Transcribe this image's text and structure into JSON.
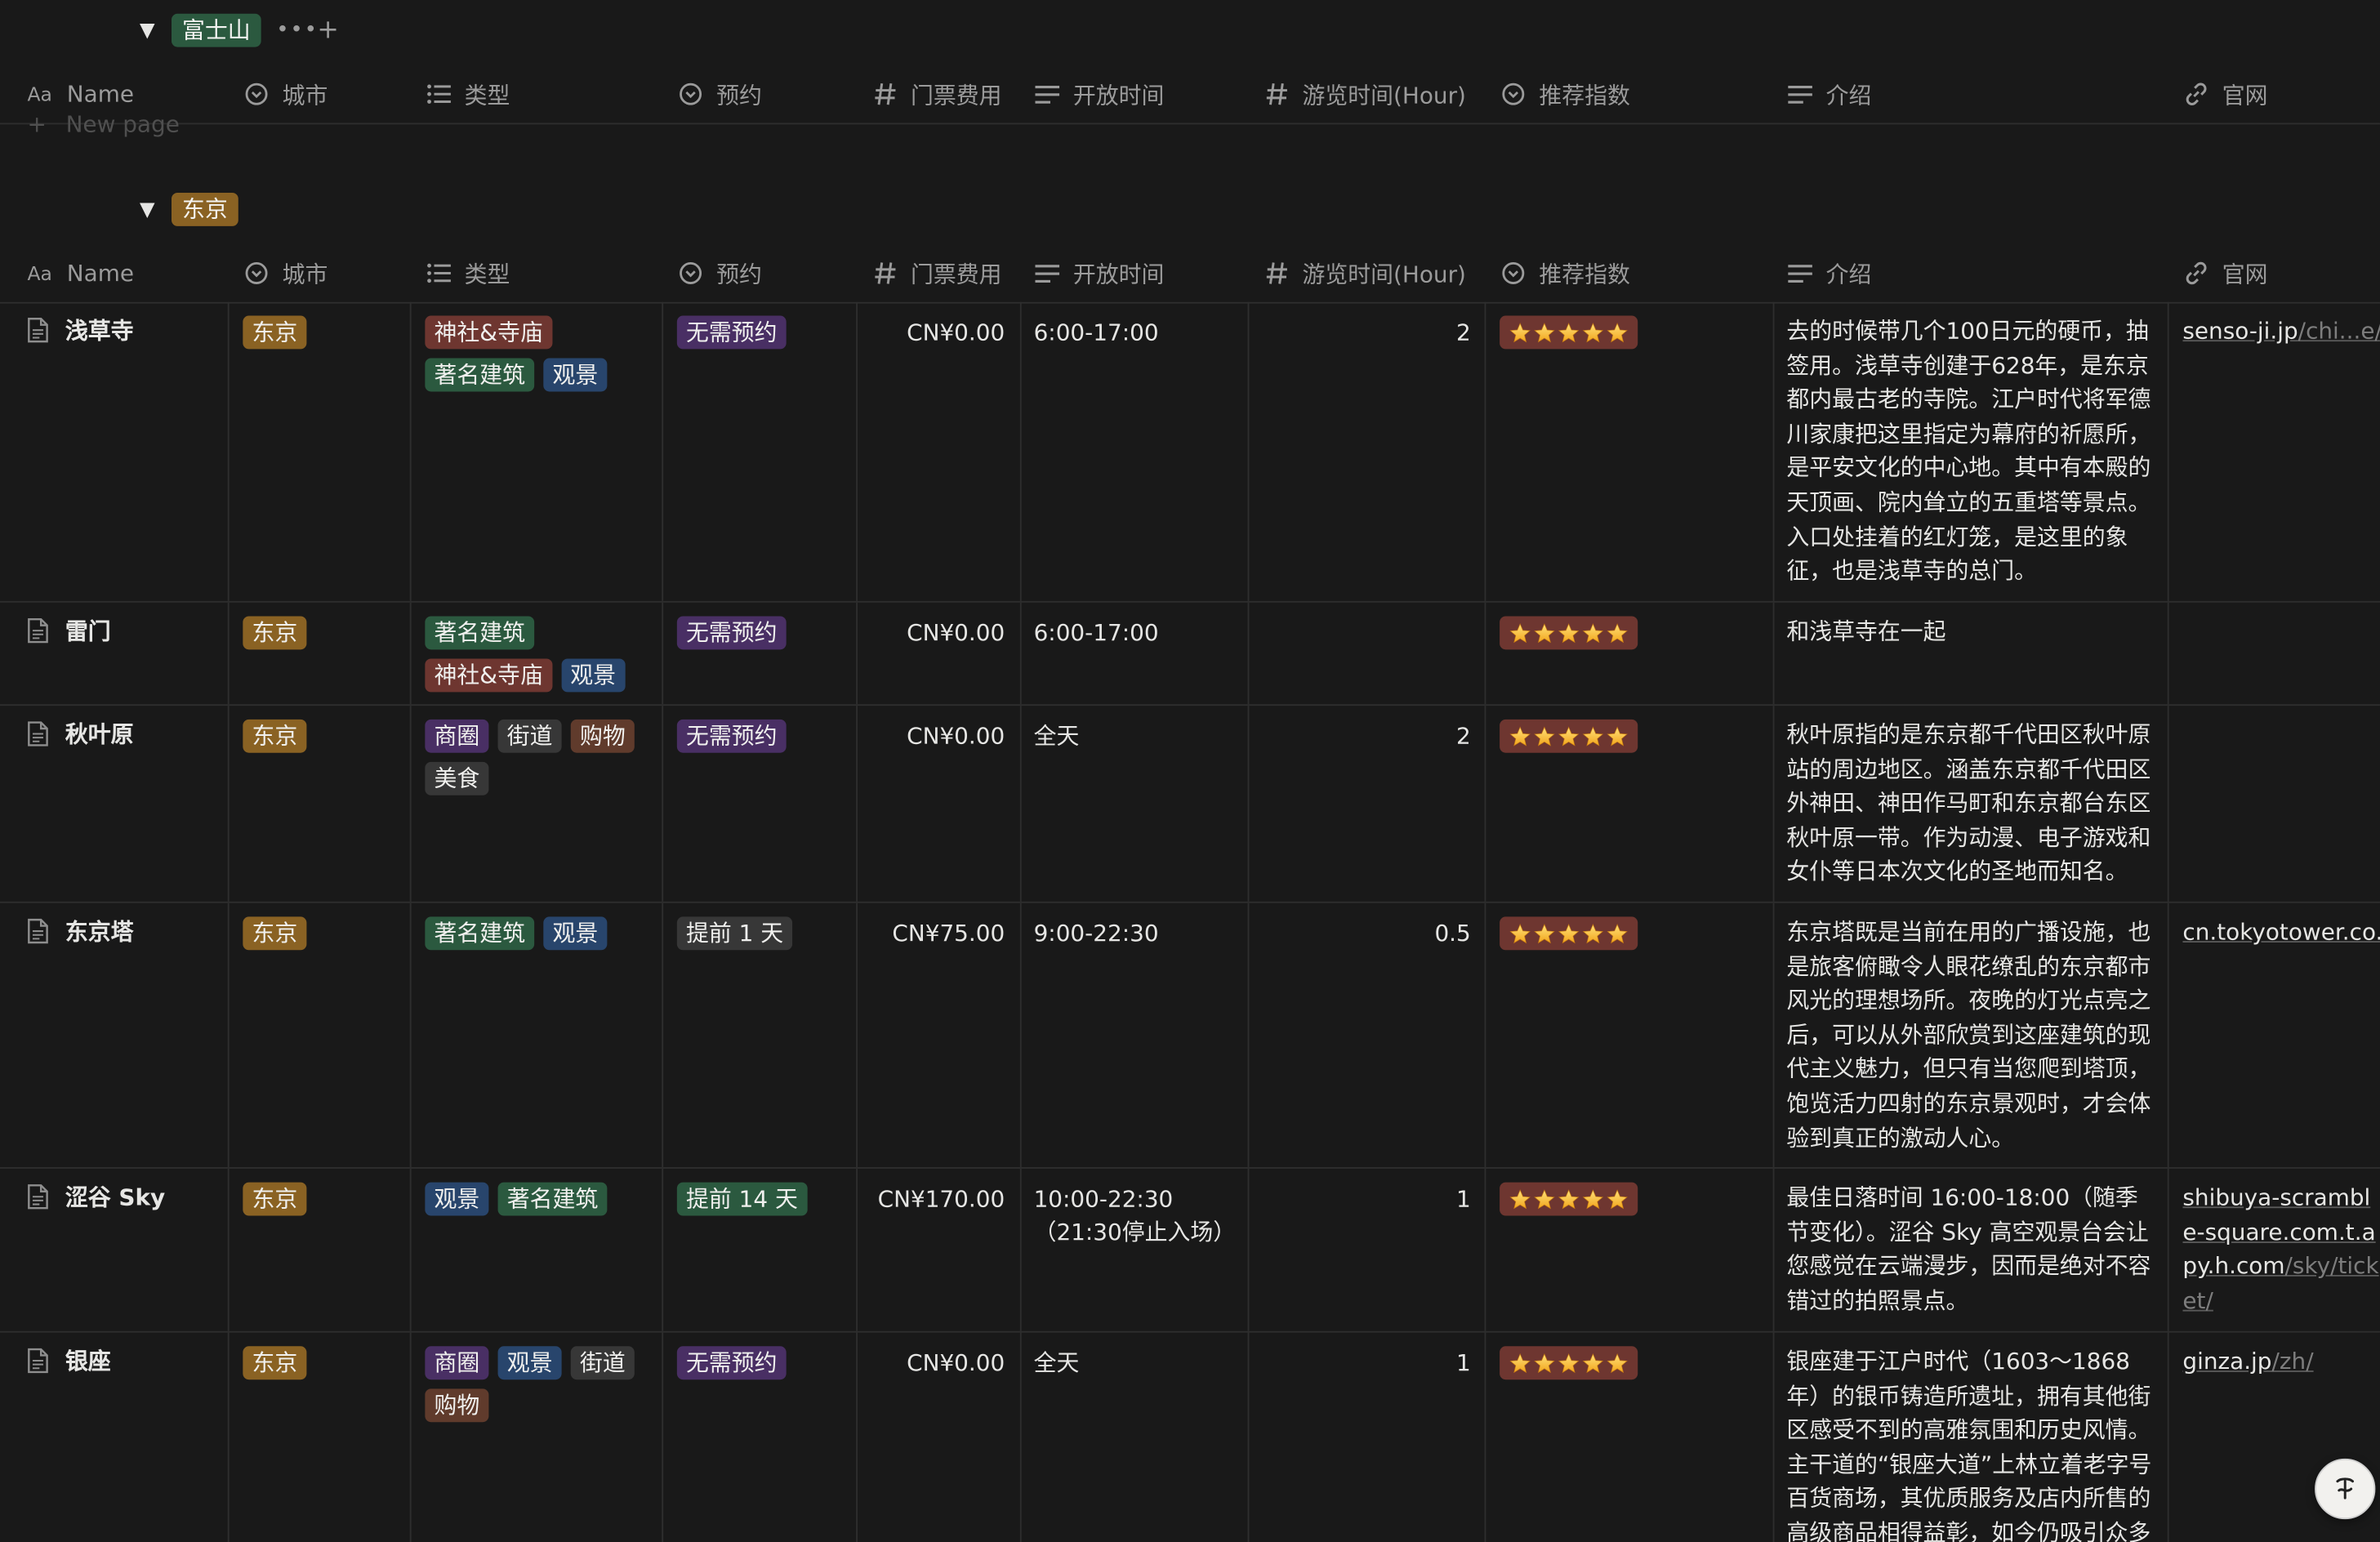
{
  "colors": {
    "background": "#191919",
    "text": "#e6e6e4",
    "muted": "#9b9b9b",
    "divider": "#2e2e2e",
    "tag_green": "#2b593f",
    "tag_brown": "#8a6223",
    "tag_red": "#6e3630",
    "tag_blue": "#28456c",
    "tag_purple": "#492f64",
    "tag_gray": "#373737",
    "tag_orange_brown": "#603b2c"
  },
  "groups": {
    "fuji": {
      "label": "富士山",
      "new_page_label": "New page"
    },
    "tokyo": {
      "label": "东京"
    }
  },
  "columns": {
    "name": "Name",
    "city": "城市",
    "type": "类型",
    "booking": "预约",
    "fee": "门票费用",
    "hours": "开放时间",
    "duration": "游览时间(Hour)",
    "rating": "推荐指数",
    "intro": "介绍",
    "website": "官网"
  },
  "icons": {
    "name": "text-aa-icon",
    "city": "select-icon",
    "type": "multi-select-icon",
    "booking": "select-icon",
    "fee": "number-icon",
    "hours": "text-lines-icon",
    "duration": "number-icon",
    "rating": "select-icon",
    "intro": "text-lines-icon",
    "website": "link-icon"
  },
  "rows": [
    {
      "name": "浅草寺",
      "city": "东京",
      "types": [
        {
          "label": "神社&寺庙",
          "color": "red"
        },
        {
          "label": "著名建筑",
          "color": "green"
        },
        {
          "label": "观景",
          "color": "blue"
        }
      ],
      "booking": {
        "label": "无需预约",
        "color": "purple"
      },
      "fee": "CN¥0.00",
      "hours": "6:00-17:00",
      "duration": "2",
      "rating": 5,
      "intro": "去的时候带几个100日元的硬币，抽签用。浅草寺创建于628年，是东京都内最古老的寺院。江户时代将军德川家康把这里指定为幕府的祈愿所，是平安文化的中心地。其中有本殿的天顶画、院内耸立的五重塔等景点。入口处挂着的红灯笼，是这里的象征，也是浅草寺的总门。",
      "website_main": "senso-ji.jp",
      "website_dim": "/chi...e/k"
    },
    {
      "name": "雷门",
      "city": "东京",
      "types": [
        {
          "label": "著名建筑",
          "color": "green"
        },
        {
          "label": "神社&寺庙",
          "color": "red"
        },
        {
          "label": "观景",
          "color": "blue"
        }
      ],
      "booking": {
        "label": "无需预约",
        "color": "purple"
      },
      "fee": "CN¥0.00",
      "hours": "6:00-17:00",
      "duration": "",
      "rating": 5,
      "intro": "和浅草寺在一起",
      "website_main": "",
      "website_dim": ""
    },
    {
      "name": "秋叶原",
      "city": "东京",
      "types": [
        {
          "label": "商圈",
          "color": "purple"
        },
        {
          "label": "街道",
          "color": "gray"
        },
        {
          "label": "购物",
          "color": "orange_brown"
        },
        {
          "label": "美食",
          "color": "gray"
        }
      ],
      "booking": {
        "label": "无需预约",
        "color": "purple"
      },
      "fee": "CN¥0.00",
      "hours": "全天",
      "duration": "2",
      "rating": 5,
      "intro": "秋叶原指的是东京都千代田区秋叶原站的周边地区。涵盖东京都千代田区外神田、神田作马町和东京都台东区秋叶原一带。作为动漫、电子游戏和女仆等日本次文化的圣地而知名。",
      "website_main": "",
      "website_dim": ""
    },
    {
      "name": "东京塔",
      "city": "东京",
      "types": [
        {
          "label": "著名建筑",
          "color": "green"
        },
        {
          "label": "观景",
          "color": "blue"
        }
      ],
      "booking": {
        "label": "提前 1 天",
        "color": "gray"
      },
      "fee": "CN¥75.00",
      "hours": "9:00-22:30",
      "duration": "0.5",
      "rating": 5,
      "intro": "东京塔既是当前在用的广播设施，也是旅客俯瞰令人眼花缭乱的东京都市风光的理想场所。夜晚的灯光点亮之后，可以从外部欣赏到这座建筑的现代主义魅力，但只有当您爬到塔顶，饱览活力四射的东京景观时，才会体验到真正的激动人心。",
      "website_main": "cn.tokyotower.co.jp",
      "website_dim": ""
    },
    {
      "name": "涩谷 Sky",
      "city": "东京",
      "types": [
        {
          "label": "观景",
          "color": "blue"
        },
        {
          "label": "著名建筑",
          "color": "green"
        }
      ],
      "booking": {
        "label": "提前 14 天",
        "color": "green"
      },
      "fee": "CN¥170.00",
      "hours": "10:00-22:30",
      "hours2": "（21:30停止入场）",
      "duration": "1",
      "rating": 5,
      "intro": "最佳日落时间 16:00-18:00（随季节变化）。涩谷 Sky 高空观景台会让您感觉在云端漫步，因而是绝对不容错过的拍照景点。",
      "website_main": "shibuya-scramble-square.com.t.apy.h.com",
      "website_dim": "/sky/ticket/"
    },
    {
      "name": "银座",
      "city": "东京",
      "types": [
        {
          "label": "商圈",
          "color": "purple"
        },
        {
          "label": "观景",
          "color": "blue"
        },
        {
          "label": "街道",
          "color": "gray"
        },
        {
          "label": "购物",
          "color": "orange_brown"
        }
      ],
      "booking": {
        "label": "无需预约",
        "color": "purple"
      },
      "fee": "CN¥0.00",
      "hours": "全天",
      "duration": "1",
      "rating": 5,
      "intro": "银座建于江户时代（1603～1868年）的银币铸造所遗址，拥有其他街区感受不到的高雅氛围和历史风情。主干道的“银座大道”上林立着老字号百货商场，其优质服务及店内所售的高级商品相得益彰，如今仍吸引众多",
      "website_main": "ginza.jp",
      "website_dim": "/zh/"
    }
  ]
}
